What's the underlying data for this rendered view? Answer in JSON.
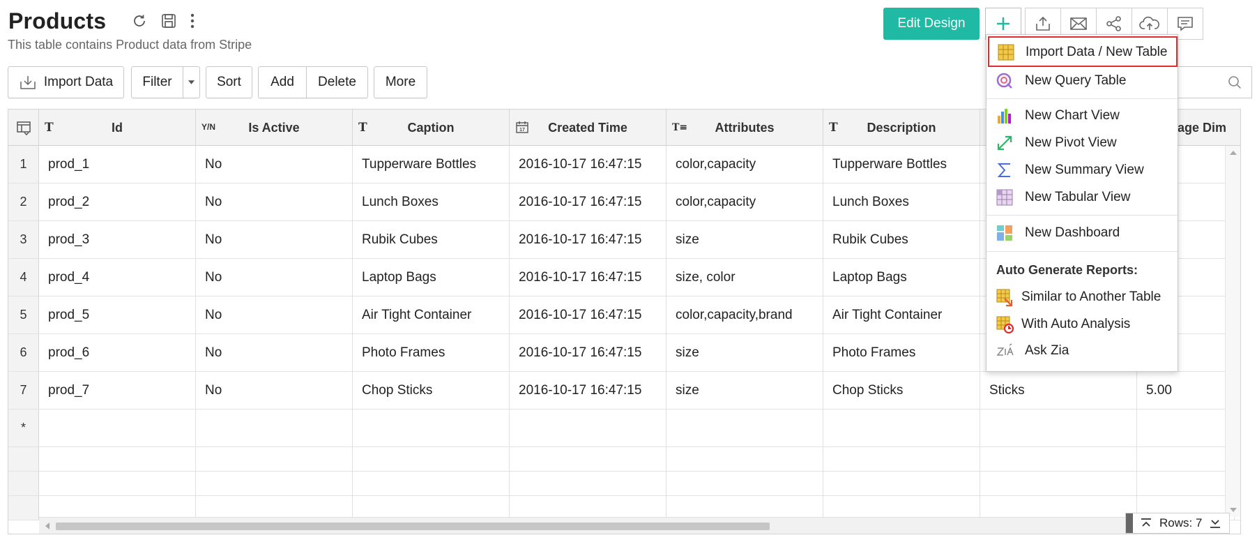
{
  "header": {
    "title": "Products",
    "subtitle": "This table contains Product data from Stripe",
    "edit_design_label": "Edit Design"
  },
  "toolbar": {
    "import_label": "Import Data",
    "filter_label": "Filter",
    "sort_label": "Sort",
    "add_label": "Add",
    "delete_label": "Delete",
    "more_label": "More"
  },
  "table": {
    "columns": [
      {
        "type_glyph": "T",
        "label": "Id"
      },
      {
        "type_glyph": "Y/N",
        "label": "Is Active"
      },
      {
        "type_glyph": "T",
        "label": "Caption"
      },
      {
        "type_glyph": "calendar",
        "label": "Created Time"
      },
      {
        "type_glyph": "T≡",
        "label": "Attributes"
      },
      {
        "type_glyph": "T",
        "label": "Description"
      },
      {
        "type_glyph": "",
        "label": ""
      },
      {
        "type_glyph": "",
        "label": "ckage Dim"
      }
    ],
    "rows": [
      {
        "num": "1",
        "cells": [
          "prod_1",
          "No",
          "Tupperware Bottles",
          "2016-10-17 16:47:15",
          "color,capacity",
          "Tupperware Bottles",
          "",
          ""
        ]
      },
      {
        "num": "2",
        "cells": [
          "prod_2",
          "No",
          "Lunch Boxes",
          "2016-10-17 16:47:15",
          "color,capacity",
          "Lunch Boxes",
          "",
          ""
        ]
      },
      {
        "num": "3",
        "cells": [
          "prod_3",
          "No",
          "Rubik Cubes",
          "2016-10-17 16:47:15",
          "size",
          "Rubik Cubes",
          "",
          ""
        ]
      },
      {
        "num": "4",
        "cells": [
          "prod_4",
          "No",
          "Laptop Bags",
          "2016-10-17 16:47:15",
          "size, color",
          "Laptop Bags",
          "",
          ""
        ]
      },
      {
        "num": "5",
        "cells": [
          "prod_5",
          "No",
          "Air Tight Container",
          "2016-10-17 16:47:15",
          "color,capacity,brand",
          "Air Tight Container",
          "",
          ""
        ]
      },
      {
        "num": "6",
        "cells": [
          "prod_6",
          "No",
          "Photo Frames",
          "2016-10-17 16:47:15",
          "size",
          "Photo Frames",
          "",
          ""
        ]
      },
      {
        "num": "7",
        "cells": [
          "prod_7",
          "No",
          "Chop Sticks",
          "2016-10-17 16:47:15",
          "size",
          "Chop Sticks",
          "Sticks",
          "5.00"
        ]
      }
    ],
    "new_row_marker": "*",
    "rows_counter": "Rows: 7"
  },
  "menu": {
    "import_new_table": "Import Data / New Table",
    "new_query_table": "New Query Table",
    "new_chart_view": "New Chart View",
    "new_pivot_view": "New Pivot View",
    "new_summary_view": "New Summary View",
    "new_tabular_view": "New Tabular View",
    "new_dashboard": "New Dashboard",
    "auto_section": "Auto Generate Reports:",
    "similar_table": "Similar to Another Table",
    "auto_analysis": "With Auto Analysis",
    "ask_zia": "Ask Zia"
  },
  "colors": {
    "accent": "#1fb9a4",
    "highlight_border": "#e32b2b"
  }
}
